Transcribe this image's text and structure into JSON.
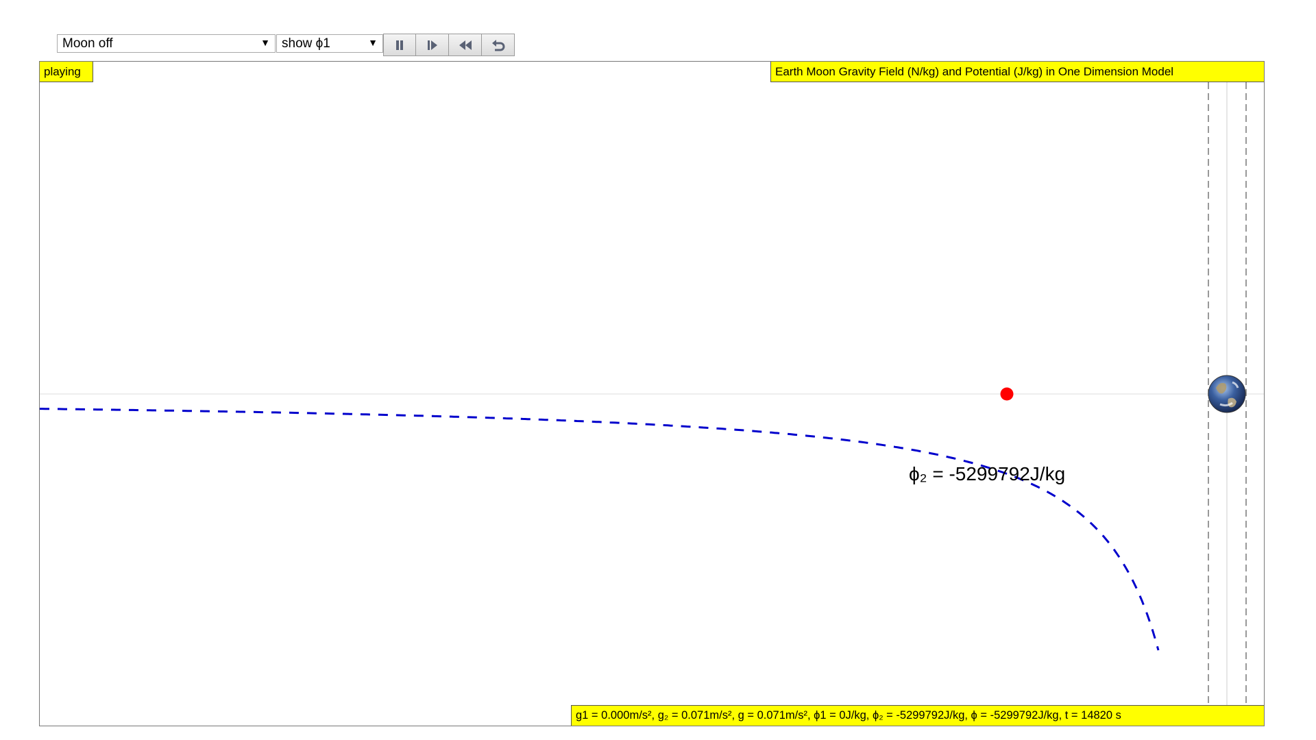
{
  "controls": {
    "mode_select": "Moon off",
    "phi_select": "show ϕ1",
    "buttons": [
      "pause-icon",
      "step-forward-icon",
      "rewind-icon",
      "reset-icon"
    ]
  },
  "plot": {
    "status": "playing",
    "title": "Earth Moon Gravity Field (N/kg) and Potential (J/kg) in One Dimension Model",
    "potential_label": "ϕ₂ = -5299792J/kg",
    "readout": "g1 = 0.000m/s², g₂ = 0.071m/s², g = 0.071m/s², ϕ1 = 0J/kg, ϕ₂ = -5299792J/kg, ϕ = -5299792J/kg, t = 14820 s"
  },
  "colors": {
    "tag_background": "#ffff00",
    "potential_curve": "#0000cc",
    "probe": "#ff0000"
  }
}
